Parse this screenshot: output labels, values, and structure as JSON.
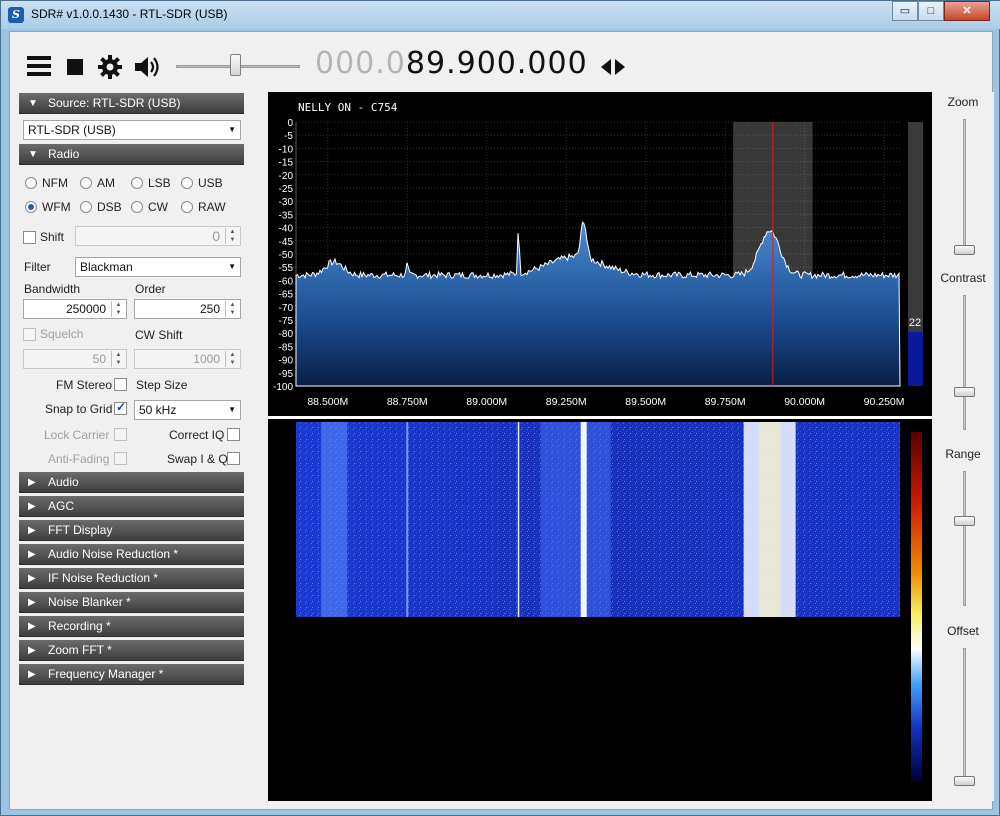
{
  "window": {
    "title": "SDR# v1.0.0.1430 - RTL-SDR (USB)",
    "app_icon_glyph": "S",
    "controls": {
      "minimize": "▭",
      "maximize": "□",
      "close": "✕"
    }
  },
  "toolbar": {
    "menu_icon": "hamburger-icon",
    "stop_icon": "stop-icon",
    "settings_icon": "gear-icon",
    "audio_icon": "speaker-icon",
    "volume": 0.5,
    "frequency_dim": "000.0",
    "frequency_lit": "89.900.000"
  },
  "source": {
    "header": "Source: RTL-SDR (USB)",
    "device": "RTL-SDR (USB)"
  },
  "radio": {
    "header": "Radio",
    "modes": [
      "NFM",
      "AM",
      "LSB",
      "USB",
      "WFM",
      "DSB",
      "CW",
      "RAW"
    ],
    "selected_mode": "WFM",
    "shift_label": "Shift",
    "shift_value": "0",
    "filter_label": "Filter",
    "filter_value": "Blackman",
    "bandwidth_label": "Bandwidth",
    "bandwidth_value": "250000",
    "order_label": "Order",
    "order_value": "250",
    "squelch_label": "Squelch",
    "squelch_value": "50",
    "cw_shift_label": "CW Shift",
    "cw_shift_value": "1000",
    "fm_stereo_label": "FM Stereo",
    "step_size_label": "Step Size",
    "snap_label": "Snap to Grid",
    "step_value": "50 kHz",
    "lock_carrier_label": "Lock Carrier",
    "correct_iq_label": "Correct IQ",
    "anti_fading_label": "Anti-Fading",
    "swap_iq_label": "Swap I & Q"
  },
  "collapsed_sections": [
    "Audio",
    "AGC",
    "FFT Display",
    "Audio Noise Reduction *",
    "IF Noise Reduction *",
    "Noise Blanker *",
    "Recording *",
    "Zoom FFT *",
    "Frequency Manager *"
  ],
  "spectrum": {
    "rds_text": "NELLY ON - C754",
    "db_ticks": [
      "0",
      "-5",
      "-10",
      "-15",
      "-20",
      "-25",
      "-30",
      "-35",
      "-40",
      "-45",
      "-50",
      "-55",
      "-60",
      "-65",
      "-70",
      "-75",
      "-80",
      "-85",
      "-90",
      "-95",
      "-100"
    ],
    "freq_ticks": [
      "88.500M",
      "88.750M",
      "89.000M",
      "89.250M",
      "89.500M",
      "89.750M",
      "90.000M",
      "90.250M"
    ],
    "level_value": "22",
    "colors": {
      "fill_top": "#3f7ec2",
      "fill_bottom": "#0a2552",
      "grid": "#3a3a3a",
      "center_line": "#e01b1b"
    }
  },
  "sliders": {
    "zoom_label": "Zoom",
    "contrast_label": "Contrast",
    "range_label": "Range",
    "offset_label": "Offset"
  }
}
